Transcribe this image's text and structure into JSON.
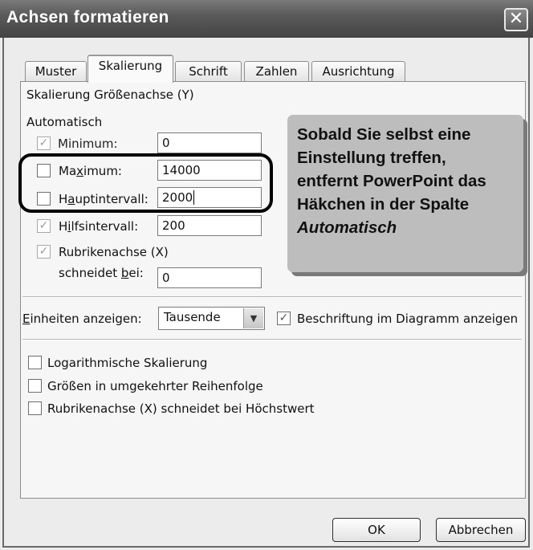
{
  "window": {
    "title": "Achsen formatieren"
  },
  "tabs": [
    "Muster",
    "Skalierung",
    "Schrift",
    "Zahlen",
    "Ausrichtung"
  ],
  "active_tab": "Skalierung",
  "section_title": "Skalierung Größenachse (Y)",
  "auto_header": "Automatisch",
  "rows": {
    "minimum": {
      "label": "Minimum:",
      "value": "0",
      "auto": true
    },
    "maximum": {
      "label": "Maximum:",
      "value": "14000",
      "auto": false
    },
    "major": {
      "label": "Hauptintervall:",
      "value": "2000",
      "auto": false
    },
    "minor": {
      "label": "Hilfsintervall:",
      "value": "200",
      "auto": true
    },
    "crosses": {
      "label_line1": "Rubrikenachse (X)",
      "label_line2": "schneidet bei:",
      "value": "0",
      "auto": true
    }
  },
  "callout": {
    "text_lines": [
      "Sobald Sie selbst eine",
      "Einstellung treffen,",
      "entfernt PowerPoint das",
      "Häkchen in der Spalte"
    ],
    "emphasis": "Automatisch"
  },
  "units": {
    "label": "Einheiten anzeigen:",
    "selected": "Tausende",
    "show_label": "Beschriftung im Diagramm anzeigen",
    "show_label_checked": true
  },
  "options": [
    {
      "label": "Logarithmische Skalierung",
      "checked": false
    },
    {
      "label": "Größen in umgekehrter Reihenfolge",
      "checked": false
    },
    {
      "label": "Rubrikenachse (X) schneidet bei Höchstwert",
      "checked": false
    }
  ],
  "buttons": {
    "ok": "OK",
    "cancel": "Abbrechen"
  },
  "icons": {
    "close": "close-icon",
    "check": "checkmark-icon",
    "dropdown": "chevron-down-icon"
  }
}
